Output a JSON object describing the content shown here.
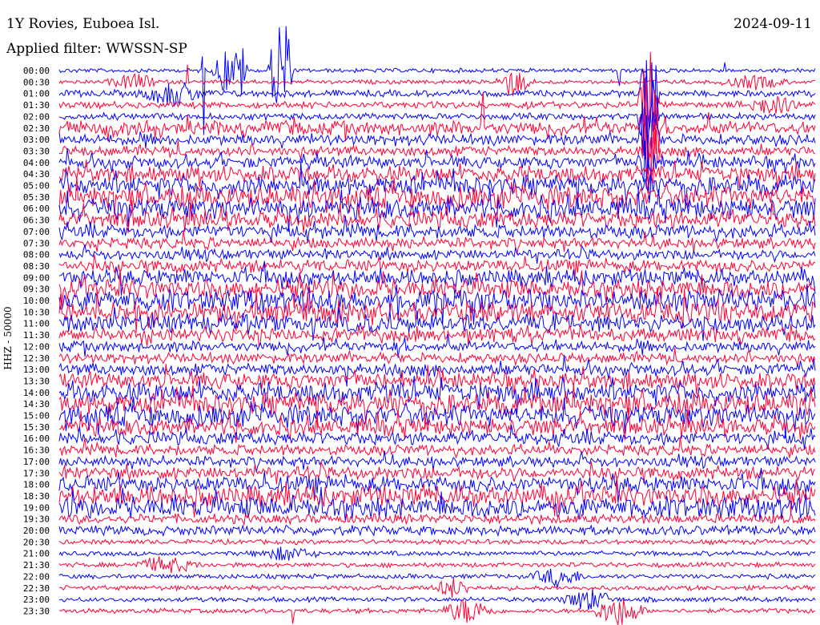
{
  "header": {
    "station": "1Y Rovies, Euboea Isl.",
    "filter": "Applied filter: WWSSN-SP",
    "date": "2024-09-11"
  },
  "chart_data": {
    "type": "line",
    "title": "1Y Rovies, Euboea Isl.",
    "subtitle": "Applied filter: WWSSN-SP",
    "date": "2024-09-11",
    "ylabel": "HHZ - 50000",
    "rows": [
      "00:00",
      "00:30",
      "01:00",
      "01:30",
      "02:00",
      "02:30",
      "03:00",
      "03:30",
      "04:00",
      "04:30",
      "05:00",
      "05:30",
      "06:00",
      "06:30",
      "07:00",
      "07:30",
      "08:00",
      "08:30",
      "09:00",
      "09:30",
      "10:00",
      "10:30",
      "11:00",
      "11:30",
      "12:00",
      "12:30",
      "13:00",
      "13:30",
      "14:00",
      "14:30",
      "15:00",
      "15:30",
      "16:00",
      "16:30",
      "17:00",
      "17:30",
      "18:00",
      "18:30",
      "19:00",
      "19:30",
      "20:00",
      "20:30",
      "21:00",
      "21:30",
      "22:00",
      "22:30",
      "23:00",
      "23:30"
    ],
    "row_minutes": 30,
    "series_colors": [
      "#0000ff",
      "#ff0033"
    ],
    "grid": false,
    "legend": "none"
  }
}
